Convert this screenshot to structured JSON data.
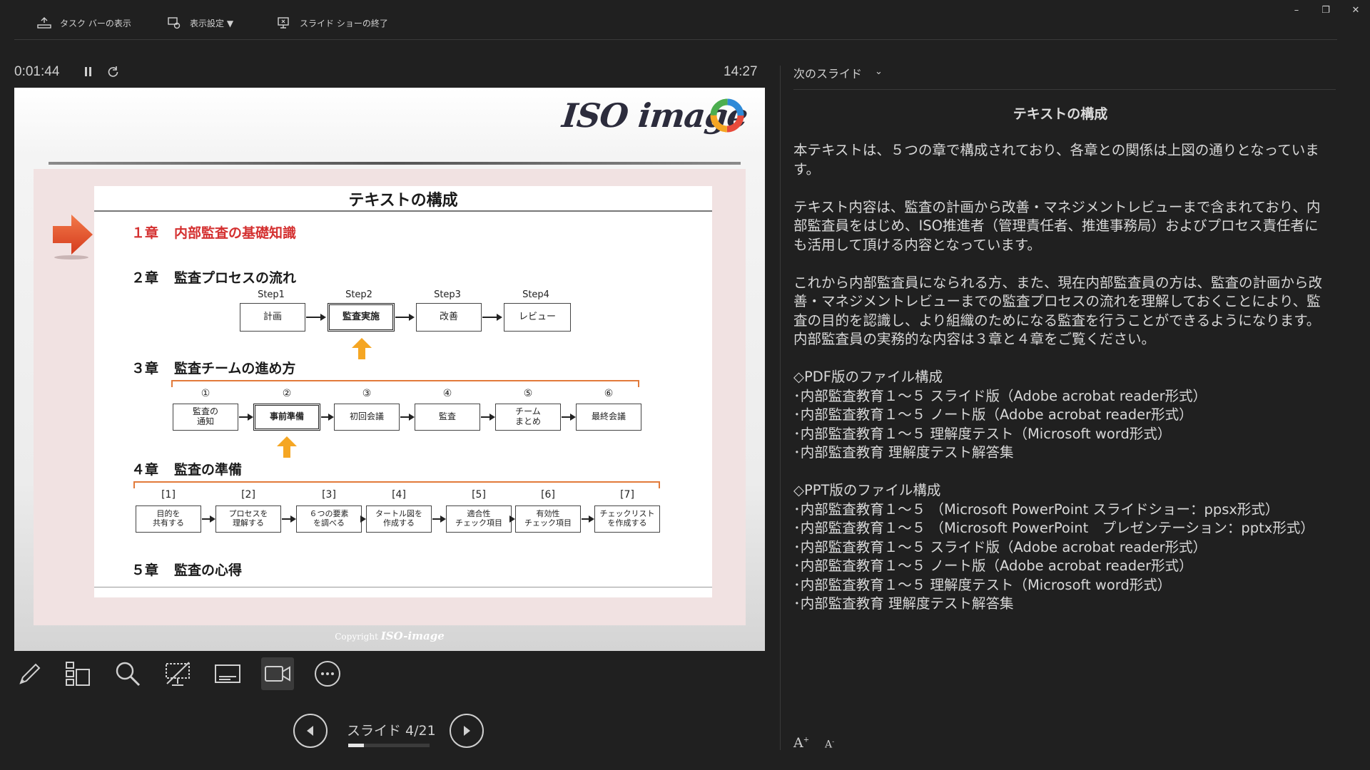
{
  "toolbar": {
    "show_taskbar": "タスク バーの表示",
    "display_settings": "表示設定 ▼",
    "end_slideshow": "スライド ショーの終了"
  },
  "window": {
    "minimize": "–",
    "restore": "❐",
    "close": "✕"
  },
  "presenter": {
    "elapsed": "0:01:44",
    "clock": "14:27",
    "slide_counter": "スライド 4/21",
    "progress": 0.19
  },
  "slide": {
    "logo": "ISO image",
    "title": "テキストの構成",
    "chapters": [
      {
        "num": "１章",
        "title": "内部監査の基礎知識"
      },
      {
        "num": "２章",
        "title": "監査プロセスの流れ"
      },
      {
        "num": "３章",
        "title": "監査チームの進め方"
      },
      {
        "num": "４章",
        "title": "監査の準備"
      },
      {
        "num": "５章",
        "title": "監査の心得"
      }
    ],
    "ch2_steps": [
      {
        "label": "Step1",
        "box": "計画"
      },
      {
        "label": "Step2",
        "box": "監査実施"
      },
      {
        "label": "Step3",
        "box": "改善"
      },
      {
        "label": "Step4",
        "box": "レビュー"
      }
    ],
    "ch3_steps": [
      {
        "label": "①",
        "box": "監査の\n通知"
      },
      {
        "label": "②",
        "box": "事前準備"
      },
      {
        "label": "③",
        "box": "初回会議"
      },
      {
        "label": "④",
        "box": "監査"
      },
      {
        "label": "⑤",
        "box": "チーム\nまとめ"
      },
      {
        "label": "⑥",
        "box": "最終会議"
      }
    ],
    "ch4_steps": [
      {
        "label": "[1]",
        "box": "目的を\n共有する"
      },
      {
        "label": "[2]",
        "box": "プロセスを\n理解する"
      },
      {
        "label": "[3]",
        "box": "６つの要素\nを調べる"
      },
      {
        "label": "[4]",
        "box": "タートル図を\n作成する"
      },
      {
        "label": "[5]",
        "box": "適合性\nチェック項目"
      },
      {
        "label": "[6]",
        "box": "有効性\nチェック項目"
      },
      {
        "label": "[7]",
        "box": "チェックリスト\nを作成する"
      }
    ],
    "copyright_prefix": "Copyright",
    "copyright_brand": "ISO-image"
  },
  "notes": {
    "header": "次のスライド",
    "title": "テキストの構成",
    "paragraphs": [
      "本テキストは、５つの章で構成されており、各章との関係は上図の通りとなっています。",
      "テキスト内容は、監査の計画から改善・マネジメントレビューまで含まれており、内部監査員をはじめ、ISO推進者（管理責任者、推進事務局）およびプロセス責任者にも活用して頂ける内容となっています。",
      "これから内部監査員になられる方、また、現在内部監査員の方は、監査の計画から改善・マネジメントレビューまでの監査プロセスの流れを理解しておくことにより、監査の目的を認識し、より組織のためになる監査を行うことができるようになります。\n内部監査員の実務的な内容は３章と４章をご覧ください。",
      "◇PDF版のファイル構成\n･内部監査教育１～５ スライド版（Adobe acrobat reader形式）\n･内部監査教育１～５ ノート版（Adobe acrobat reader形式）\n･内部監査教育１～５ 理解度テスト（Microsoft word形式）\n･内部監査教育 理解度テスト解答集",
      "◇PPT版のファイル構成\n･内部監査教育１～５ （Microsoft PowerPoint スライドショー：ppsx形式）\n･内部監査教育１～５ （Microsoft PowerPoint　プレゼンテーション：pptx形式）\n･内部監査教育１～５ スライド版（Adobe acrobat reader形式）\n･内部監査教育１～５ ノート版（Adobe acrobat reader形式）\n･内部監査教育１～５ 理解度テスト（Microsoft word形式）\n･内部監査教育 理解度テスト解答集"
    ],
    "font_increase": "A",
    "font_decrease": "A"
  },
  "icons": [
    "taskbar-icon",
    "display-settings-icon",
    "end-show-icon",
    "pause-icon",
    "restart-icon",
    "pen-icon",
    "slides-grid-icon",
    "zoom-icon",
    "black-screen-icon",
    "subtitles-icon",
    "camera-icon",
    "more-icon",
    "prev-icon",
    "next-icon"
  ]
}
